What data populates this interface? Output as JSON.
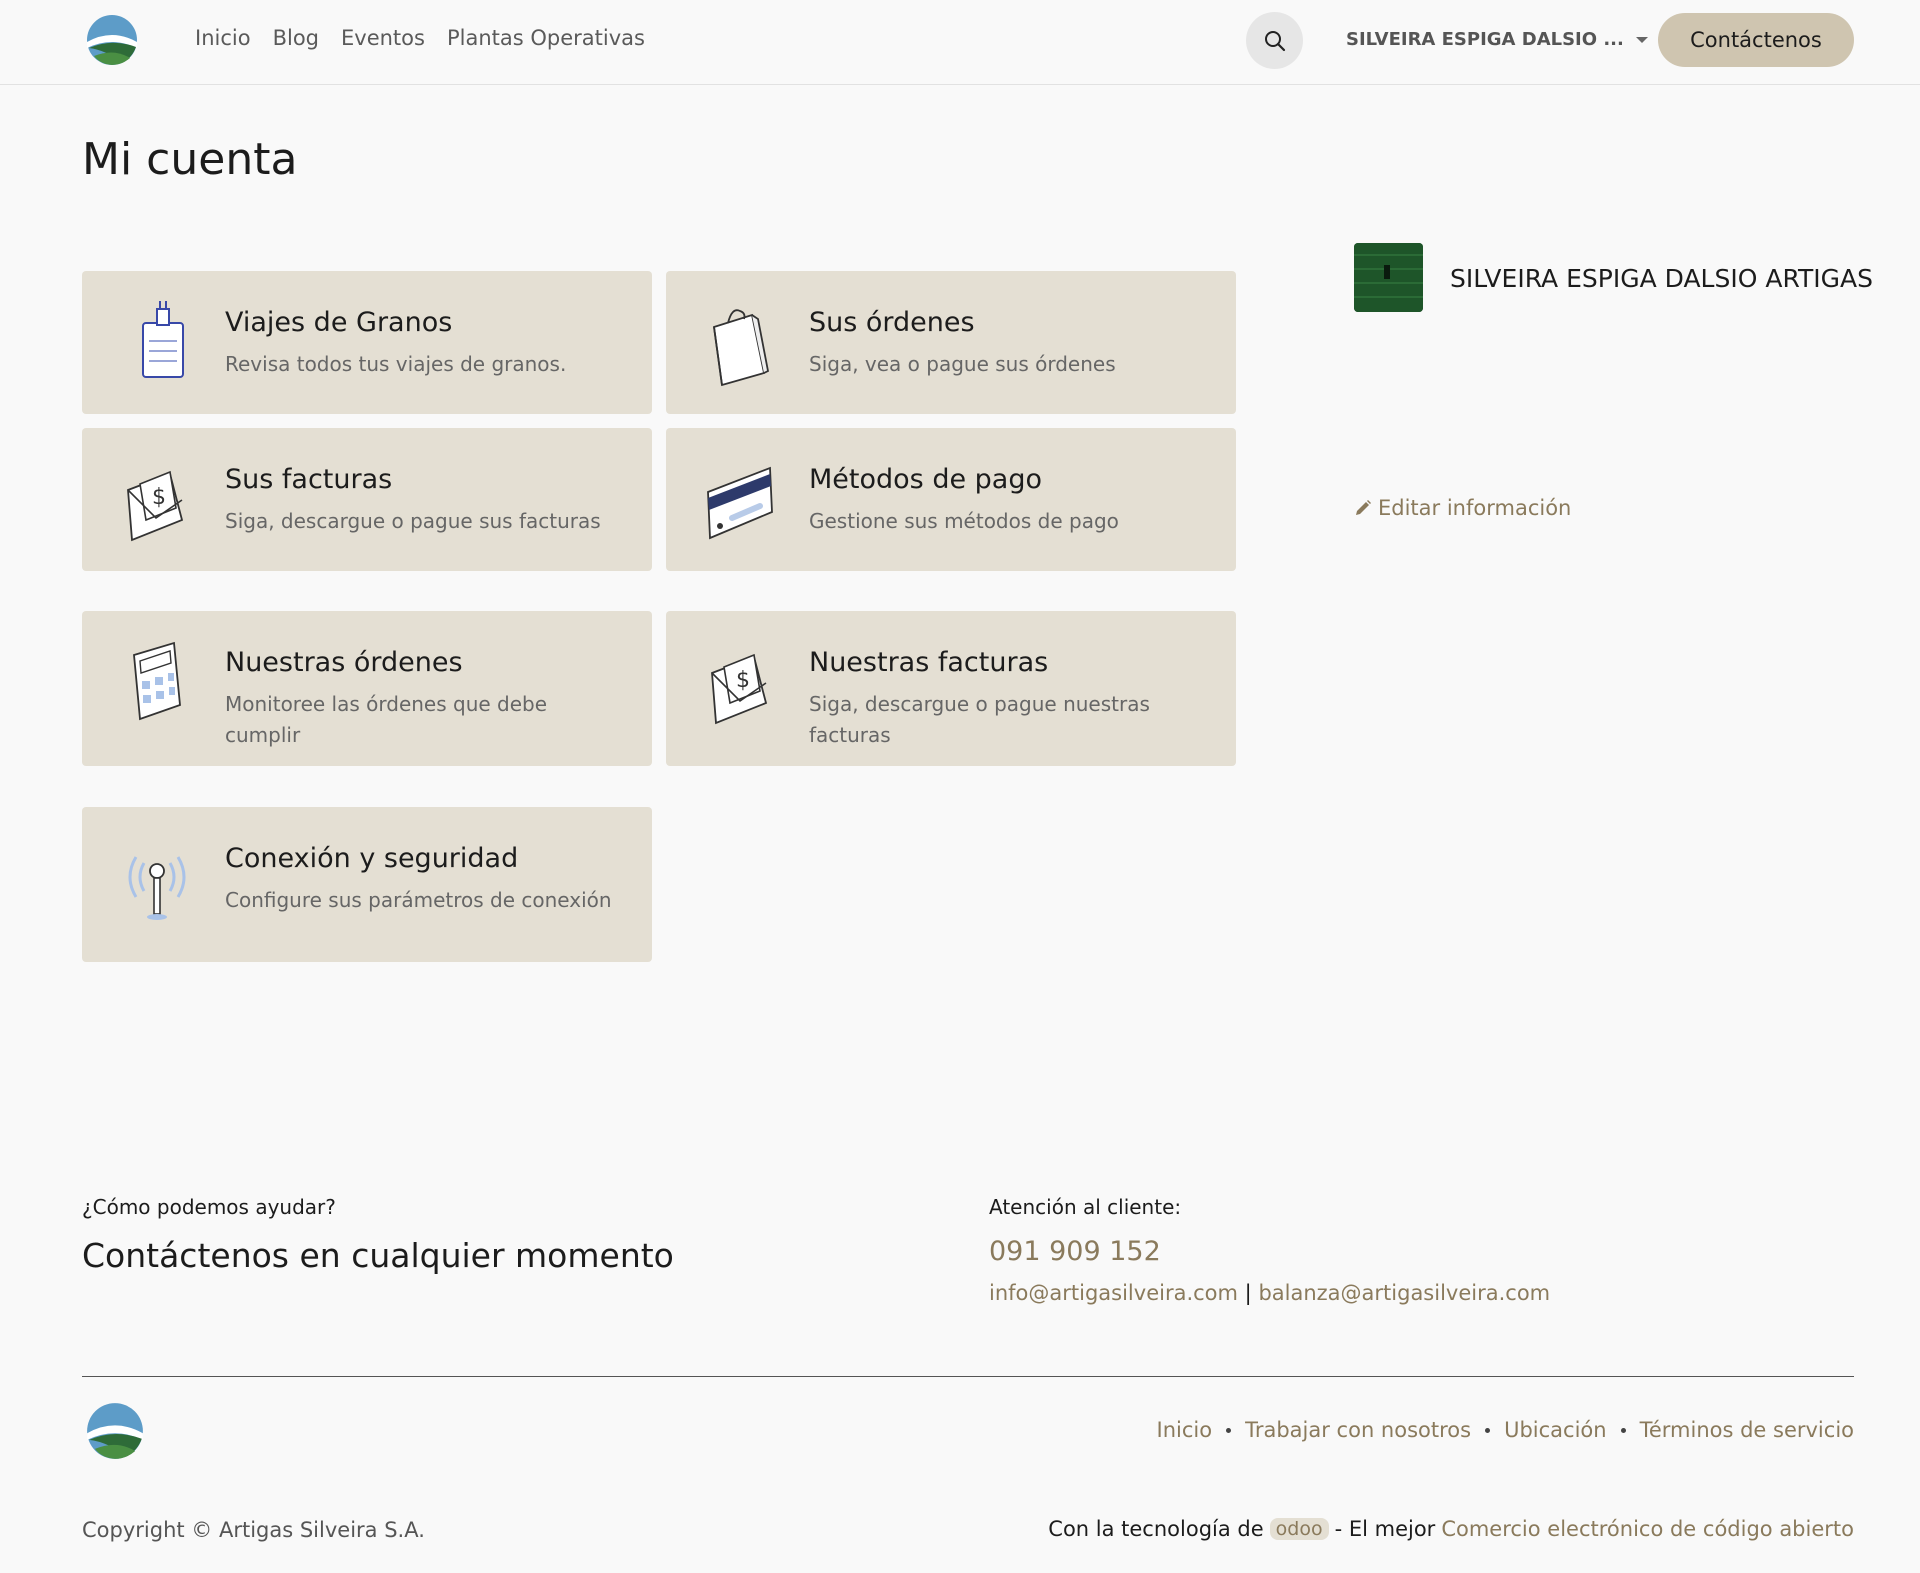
{
  "header": {
    "nav": [
      "Inicio",
      "Blog",
      "Eventos",
      "Plantas Operativas"
    ],
    "user_menu": "SILVEIRA ESPIGA DALSIO ...",
    "contact_button": "Contáctenos"
  },
  "page_title": "Mi cuenta",
  "cards": [
    {
      "title": "Viajes de Granos",
      "desc": "Revisa todos tus viajes de granos.",
      "icon": "clipboard-icon"
    },
    {
      "title": "Sus órdenes",
      "desc": "Siga, vea o pague sus órdenes",
      "icon": "shopping-bag-icon"
    },
    {
      "title": "Sus facturas",
      "desc": "Siga, descargue o pague sus facturas",
      "icon": "invoice-envelope-icon"
    },
    {
      "title": "Métodos de pago",
      "desc": "Gestione sus métodos de pago",
      "icon": "credit-card-icon"
    },
    {
      "title": "Nuestras órdenes",
      "desc": "Monitoree las órdenes que debe cumplir",
      "icon": "calculator-icon"
    },
    {
      "title": "Nuestras facturas",
      "desc": "Siga, descargue o pague nuestras facturas",
      "icon": "invoice-envelope-icon"
    },
    {
      "title": "Conexión y seguridad",
      "desc": "Configure sus parámetros de conexión",
      "icon": "antenna-icon"
    }
  ],
  "profile": {
    "name": "SILVEIRA ESPIGA DALSIO ARTIGAS",
    "edit_label": "Editar información"
  },
  "footer": {
    "help_question": "¿Cómo podemos ayudar?",
    "help_title": "Contáctenos en cualquier momento",
    "cs_label": "Atención al cliente:",
    "phone": "091 909 152",
    "email1": "info@artigasilveira.com",
    "email_sep": "|",
    "email2": "balanza@artigasilveira.com",
    "links": [
      "Inicio",
      "Trabajar con nosotros",
      "Ubicación",
      "Términos de servicio"
    ],
    "copyright": "Copyright © Artigas Silveira S.A.",
    "powered_prefix": "Con la tecnología de",
    "powered_brand": "odoo",
    "powered_mid": "- El mejor",
    "powered_link": "Comercio electrónico de código abierto"
  },
  "colors": {
    "accent": "#8a7a5c",
    "card_bg": "#e4dfd3",
    "button_bg": "#cfc5b0"
  }
}
